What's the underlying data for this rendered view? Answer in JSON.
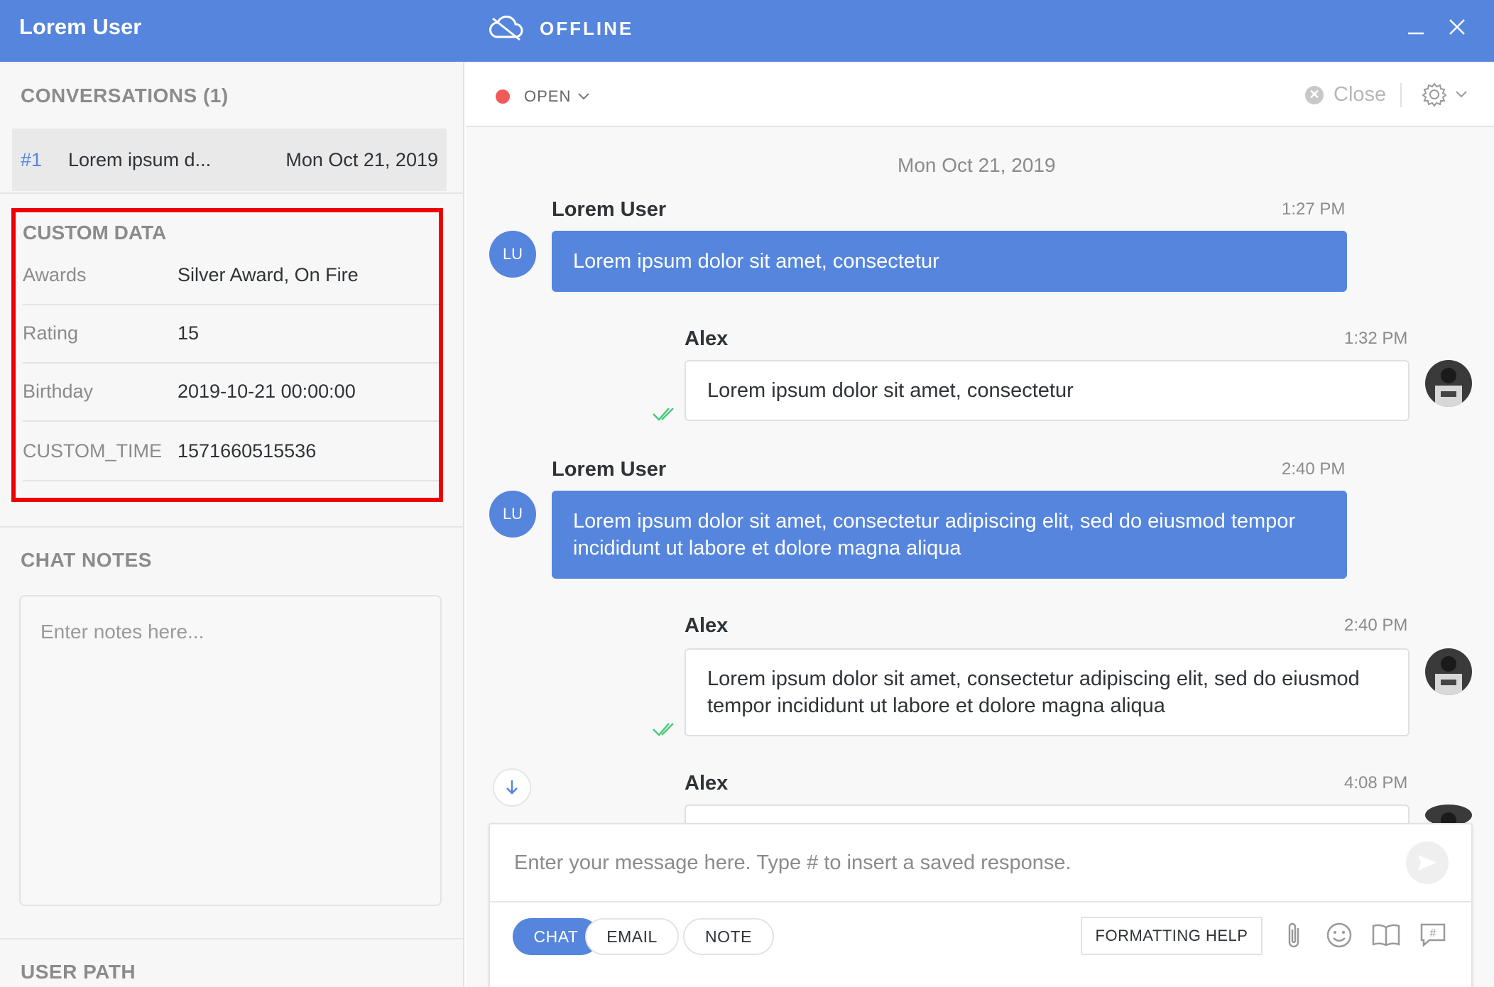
{
  "header": {
    "user_name": "Lorem User",
    "status": "OFFLINE"
  },
  "left_panel": {
    "conversations_title": "CONVERSATIONS (1)",
    "conversation": {
      "number": "#1",
      "title": "Lorem ipsum d...",
      "date": "Mon Oct 21, 2019"
    },
    "custom_data": {
      "title": "CUSTOM DATA",
      "rows": [
        {
          "key": "Awards",
          "value": "Silver Award, On Fire"
        },
        {
          "key": "Rating",
          "value": "15"
        },
        {
          "key": "Birthday",
          "value": "2019-10-21 00:00:00"
        },
        {
          "key": "CUSTOM_TIME",
          "value": "1571660515536"
        }
      ]
    },
    "chat_notes": {
      "title": "CHAT NOTES",
      "placeholder": "Enter notes here..."
    },
    "user_path_title": "USER PATH"
  },
  "chat_header": {
    "status_label": "OPEN",
    "close_label": "Close"
  },
  "chat": {
    "day_label": "Mon Oct 21, 2019",
    "messages": [
      {
        "sender": "Lorem User",
        "avatar": "LU",
        "time": "1:27 PM",
        "text": "Lorem ipsum dolor sit amet, consectetur"
      },
      {
        "sender": "Alex",
        "time": "1:32 PM",
        "text": "Lorem ipsum dolor sit amet, consectetur"
      },
      {
        "sender": "Lorem User",
        "avatar": "LU",
        "time": "2:40 PM",
        "text": "Lorem ipsum dolor sit amet, consectetur adipiscing elit, sed do eiusmod tempor incididunt ut labore et dolore magna aliqua"
      },
      {
        "sender": "Alex",
        "time": "2:40 PM",
        "text": "Lorem ipsum dolor sit amet, consectetur adipiscing elit, sed do eiusmod tempor incididunt ut labore et dolore magna aliqua"
      },
      {
        "sender": "Alex",
        "time": "4:08 PM",
        "text": ""
      }
    ]
  },
  "composer": {
    "placeholder": "Enter your message here. Type # to insert a saved response.",
    "tabs": [
      "CHAT",
      "EMAIL",
      "NOTE"
    ],
    "formatting_help": "FORMATTING HELP",
    "tools": [
      "paperclip-icon",
      "emoji-icon",
      "book-icon",
      "saved-response-icon"
    ]
  },
  "colors": {
    "accent": "#5585dc",
    "status_open": "#f25a5a",
    "read_receipt": "#4cc97e",
    "highlight_border": "#ee0000"
  }
}
